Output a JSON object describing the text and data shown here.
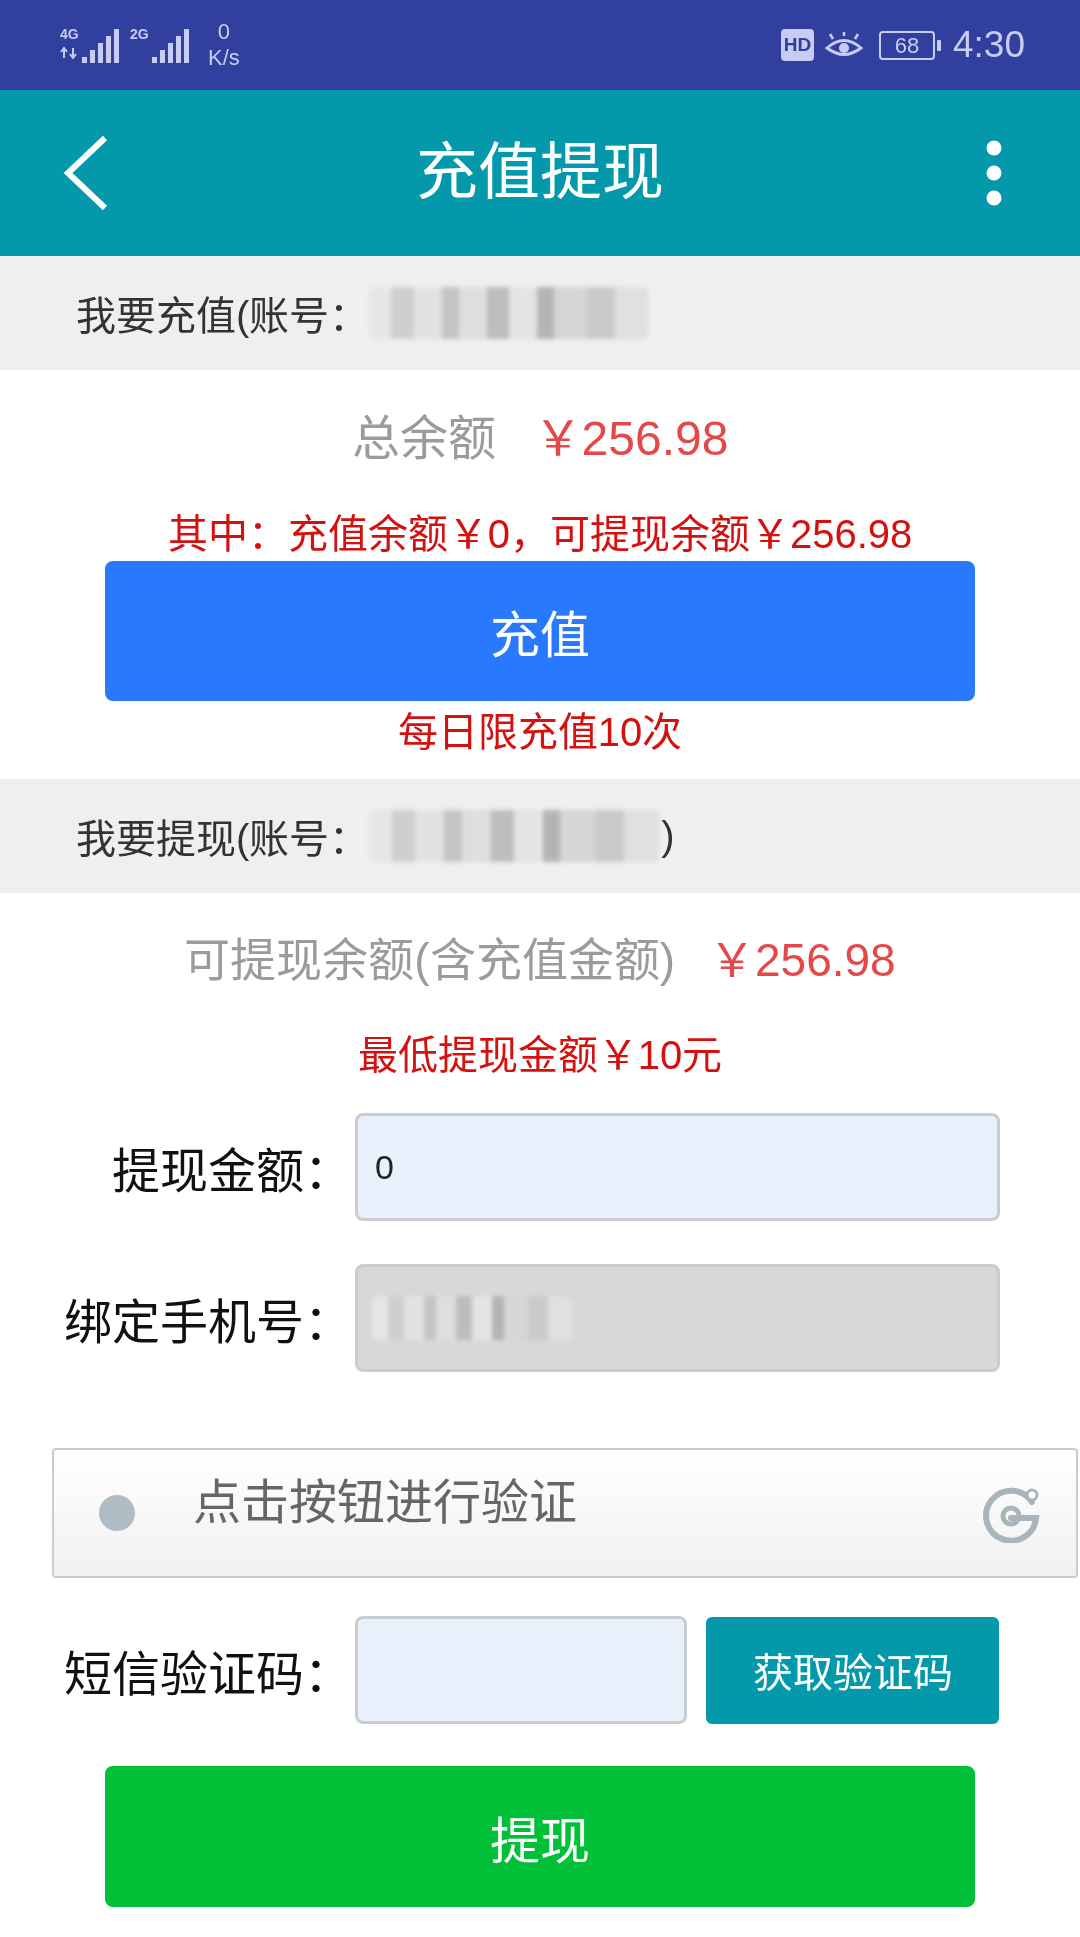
{
  "status_bar": {
    "signals": [
      {
        "label": "4G",
        "data_activity": true
      },
      {
        "label": "2G",
        "data_activity": false
      }
    ],
    "speed_value": "0",
    "speed_unit": "K/s",
    "hd_badge": "HD",
    "battery": "68",
    "time": "4:30"
  },
  "app_bar": {
    "title": "充值提现"
  },
  "recharge": {
    "header": "我要充值(账号：",
    "account_masked": true,
    "total_label": "总余额",
    "total_amount": "￥256.98",
    "breakdown": "其中：充值余额￥0，可提现余额￥256.98",
    "button": "充值",
    "limit_note": "每日限充值10次"
  },
  "withdraw": {
    "header": "我要提现(账号：",
    "account_masked": true,
    "header_end": ")",
    "available_label": "可提现余额(含充值金额)",
    "available_amount": "￥256.98",
    "minimum_note": "最低提现金额￥10元",
    "fields": [
      {
        "kind": "input",
        "label": "提现金额：",
        "value": "0"
      },
      {
        "kind": "readonly",
        "label": "绑定手机号：",
        "masked": true
      }
    ],
    "captcha": {
      "prompt": "点击按钮进行验证"
    },
    "sms": {
      "label": "短信验证码：",
      "button": "获取验证码"
    },
    "submit": "提现"
  }
}
